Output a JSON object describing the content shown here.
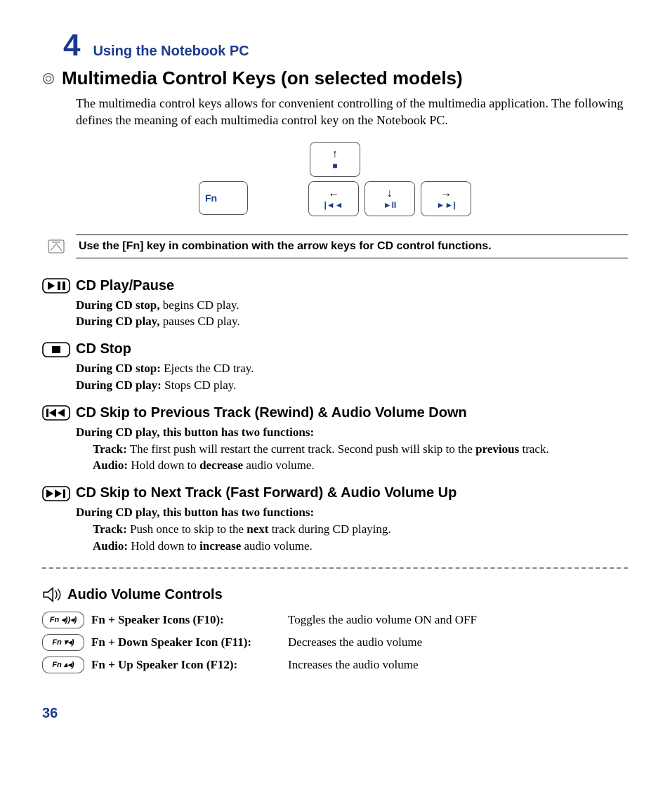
{
  "chapter": {
    "number": "4",
    "title": "Using the Notebook PC"
  },
  "h1": "Multimedia Control Keys (on selected models)",
  "intro": "The multimedia control keys allows for convenient controlling of the multimedia application. The following defines the meaning of each multimedia control key on the Notebook PC.",
  "keys": {
    "fn": "Fn",
    "up_arrow": "↑",
    "up_sym": "■",
    "left_arrow": "←",
    "left_sym": "|◄◄",
    "down_arrow": "↓",
    "down_sym": "►II",
    "right_arrow": "→",
    "right_sym": "►►|"
  },
  "note": "Use the [Fn] key in combination with the arrow keys for CD control functions.",
  "sections": {
    "play": {
      "title": "CD Play/Pause",
      "l1b": "During CD stop,",
      "l1": " begins CD play.",
      "l2b": "During CD play,",
      "l2": " pauses CD play."
    },
    "stop": {
      "title": "CD Stop",
      "l1b": "During CD stop:",
      "l1": " Ejects the CD tray.",
      "l2b": "During CD play:",
      "l2": " Stops CD play."
    },
    "prev": {
      "title": "CD Skip to Previous Track (Rewind) & Audio Volume Down",
      "lead": "During CD play, this button has two functions:",
      "t_label": "Track:",
      "t_pre": " The first push will restart the current track. Second push will skip to the ",
      "t_bold": "previous",
      "t_post": " track.",
      "a_label": "Audio:",
      "a_pre": " Hold down to ",
      "a_bold": "decrease",
      "a_post": " audio volume."
    },
    "next": {
      "title": "CD Skip to Next Track (Fast Forward) & Audio Volume Up",
      "lead": "During CD play, this button has two functions:",
      "t_label": "Track:",
      "t_pre": " Push once to skip to the ",
      "t_bold": "next",
      "t_post": " track during CD playing.",
      "a_label": "Audio:",
      "a_pre": " Hold down to ",
      "a_bold": "increase",
      "a_post": " audio volume."
    }
  },
  "volume": {
    "title": "Audio Volume Controls",
    "rows": [
      {
        "key": "Fn ◂))◂)",
        "label": "Fn + Speaker Icons (F10):",
        "desc": "Toggles the audio volume ON and OFF"
      },
      {
        "key": "Fn ▾◂)",
        "label": "Fn + Down Speaker Icon (F11):",
        "desc": "Decreases the audio volume"
      },
      {
        "key": "Fn ▴◂)",
        "label": "Fn + Up Speaker Icon (F12):",
        "desc": "Increases the audio volume"
      }
    ]
  },
  "page": "36"
}
